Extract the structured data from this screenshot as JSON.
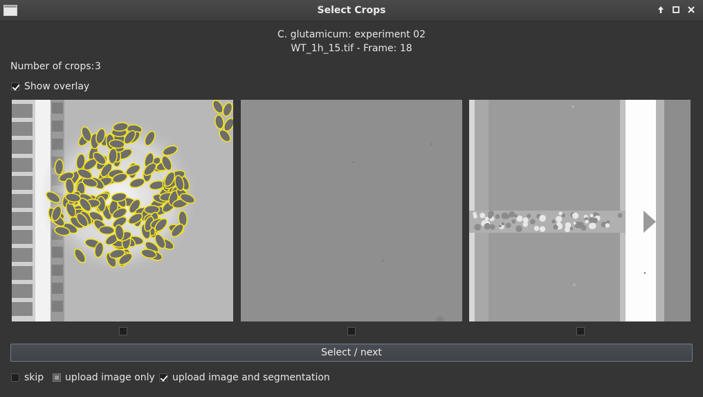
{
  "window": {
    "title": "Select Crops"
  },
  "header": {
    "line1": "C. glutamicum: experiment 02",
    "line2": "WT_1h_15.tif - Frame: 18"
  },
  "num_crops": {
    "label": "Number of crops:",
    "value": "3"
  },
  "show_overlay": {
    "label": "Show overlay",
    "checked": true
  },
  "crops": [
    {
      "selected": false
    },
    {
      "selected": false
    },
    {
      "selected": false
    }
  ],
  "select_button": {
    "label": "Select / next"
  },
  "options": {
    "skip": {
      "label": "skip",
      "checked": false
    },
    "upload_image_only": {
      "label": "upload image only",
      "checked": false
    },
    "upload_image_and_segmentation": {
      "label": "upload image and segmentation",
      "checked": true
    }
  },
  "colors": {
    "overlay": "#f2e21a",
    "accent_border": "#6c7e94"
  }
}
